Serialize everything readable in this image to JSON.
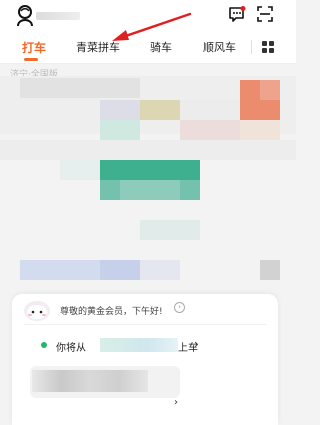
{
  "tabs": [
    {
      "label": "打车",
      "active": true
    },
    {
      "label": "青菜拼车",
      "active": false
    },
    {
      "label": "骑车",
      "active": false
    },
    {
      "label": "顺风车",
      "active": false
    }
  ],
  "colors": {
    "accent": "#f26a2a",
    "arrow": "#e02020",
    "badge": "#e02020",
    "online_dot": "#21b86a",
    "map_green": "#3fb08f"
  },
  "icons": {
    "avatar": "user-avatar-icon",
    "message": "message-icon",
    "scan": "scan-icon",
    "more": "grid-icon",
    "greeting_arrow": "arrow-right-icon"
  },
  "map": {
    "caption": "济宁·全国版"
  },
  "card": {
    "greeting": "尊敬的黄金会员，下午好!",
    "destination_prefix": "你将从",
    "destination_suffix": "上车",
    "destination_chevron": "›",
    "input_chevron": "›"
  }
}
